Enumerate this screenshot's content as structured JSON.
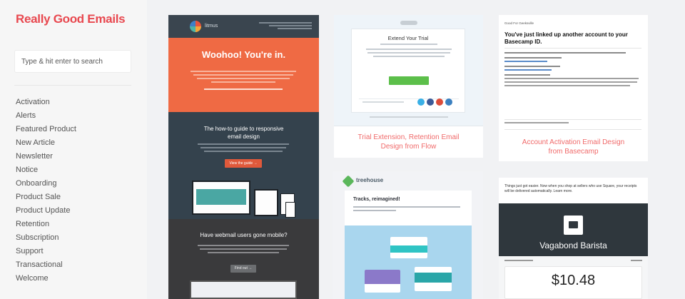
{
  "app": {
    "logo_text": "Really Good Emails"
  },
  "search": {
    "placeholder": "Type & hit enter to search"
  },
  "nav": {
    "items": [
      "Activation",
      "Alerts",
      "Featured Product",
      "New Article",
      "Newsletter",
      "Notice",
      "Onboarding",
      "Product Sale",
      "Product Update",
      "Retention",
      "Subscription",
      "Support",
      "Transactional",
      "Welcome"
    ]
  },
  "cards": {
    "litmus": {
      "brand": "litmus",
      "hero_title": "Woohoo! You're in.",
      "guide_title_1": "The how-to guide to responsive",
      "guide_title_2": "email design",
      "guide_button": "View the guide →",
      "webmail_title": "Have webmail users gone mobile?",
      "webmail_button": "Find out →"
    },
    "flow": {
      "title": "Extend Your Trial",
      "caption_1": "Trial Extension, Retention Email",
      "caption_2": "Design from Flow"
    },
    "treehouse": {
      "brand": "treehouse",
      "title": "Tracks, reimagined!"
    },
    "basecamp": {
      "from": "Good For Geeksville",
      "title": "You've just linked up another account to your Basecamp ID.",
      "caption_1": "Account Activation Email Design",
      "caption_2": "from Basecamp"
    },
    "vagabond": {
      "intro": "Things just got easier. Now when you shop at sellers who use Square, your receipts will be delivered automatically. Learn more.",
      "name": "Vagabond Barista",
      "amount": "$10.48"
    }
  },
  "colors": {
    "brand_red": "#e8484f",
    "caption_red": "#f06b6b",
    "litmus_orange": "#ef6a44",
    "litmus_slate": "#34424d",
    "flow_green": "#5cbf4a",
    "treehouse_blue": "#a9d6ee",
    "vagabond_dark": "#2f373d"
  }
}
